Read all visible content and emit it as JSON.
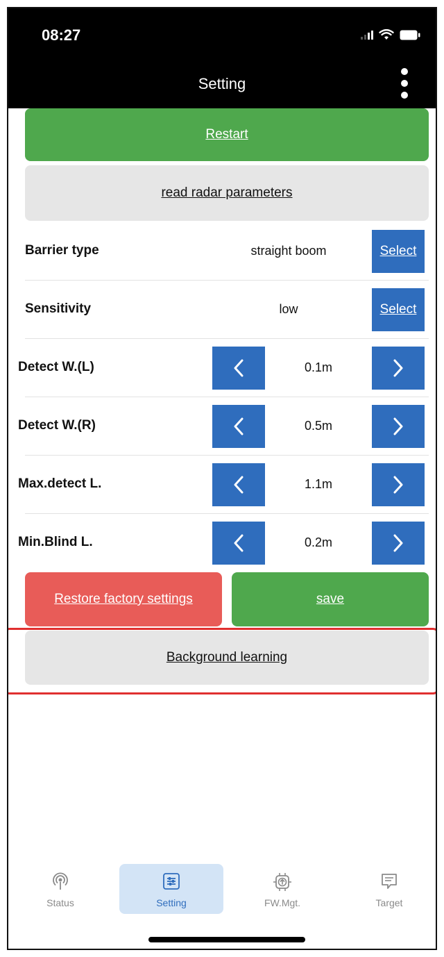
{
  "status_bar": {
    "time": "08:27"
  },
  "nav": {
    "title": "Setting",
    "more_icon": "more-vertical-icon"
  },
  "buttons": {
    "restart": "Restart",
    "read_params": "read radar parameters",
    "restore": "Restore factory settings",
    "save": "save",
    "background_learning": "Background learning"
  },
  "settings": {
    "barrier_type": {
      "label": "Barrier type",
      "value": "straight boom",
      "action": "Select"
    },
    "sensitivity": {
      "label": "Sensitivity",
      "value": "low",
      "action": "Select"
    },
    "detect_wl": {
      "label": "Detect W.(L)",
      "value": "0.1m"
    },
    "detect_wr": {
      "label": "Detect W.(R)",
      "value": "0.5m"
    },
    "max_detect": {
      "label": "Max.detect L.",
      "value": "1.1m"
    },
    "min_blind": {
      "label": "Min.Blind L.",
      "value": "0.2m"
    }
  },
  "tabs": [
    {
      "label": "Status",
      "icon": "broadcast-icon",
      "active": false
    },
    {
      "label": "Setting",
      "icon": "settings-sliders-icon",
      "active": true
    },
    {
      "label": "FW.Mgt.",
      "icon": "chip-upload-icon",
      "active": false
    },
    {
      "label": "Target",
      "icon": "message-icon",
      "active": false
    }
  ],
  "colors": {
    "green": "#4fa84d",
    "gray": "#e6e6e6",
    "red": "#e85c58",
    "blue": "#2f6dbd",
    "highlight": "#e02f2f",
    "tab_active_bg": "#d3e4f6"
  }
}
